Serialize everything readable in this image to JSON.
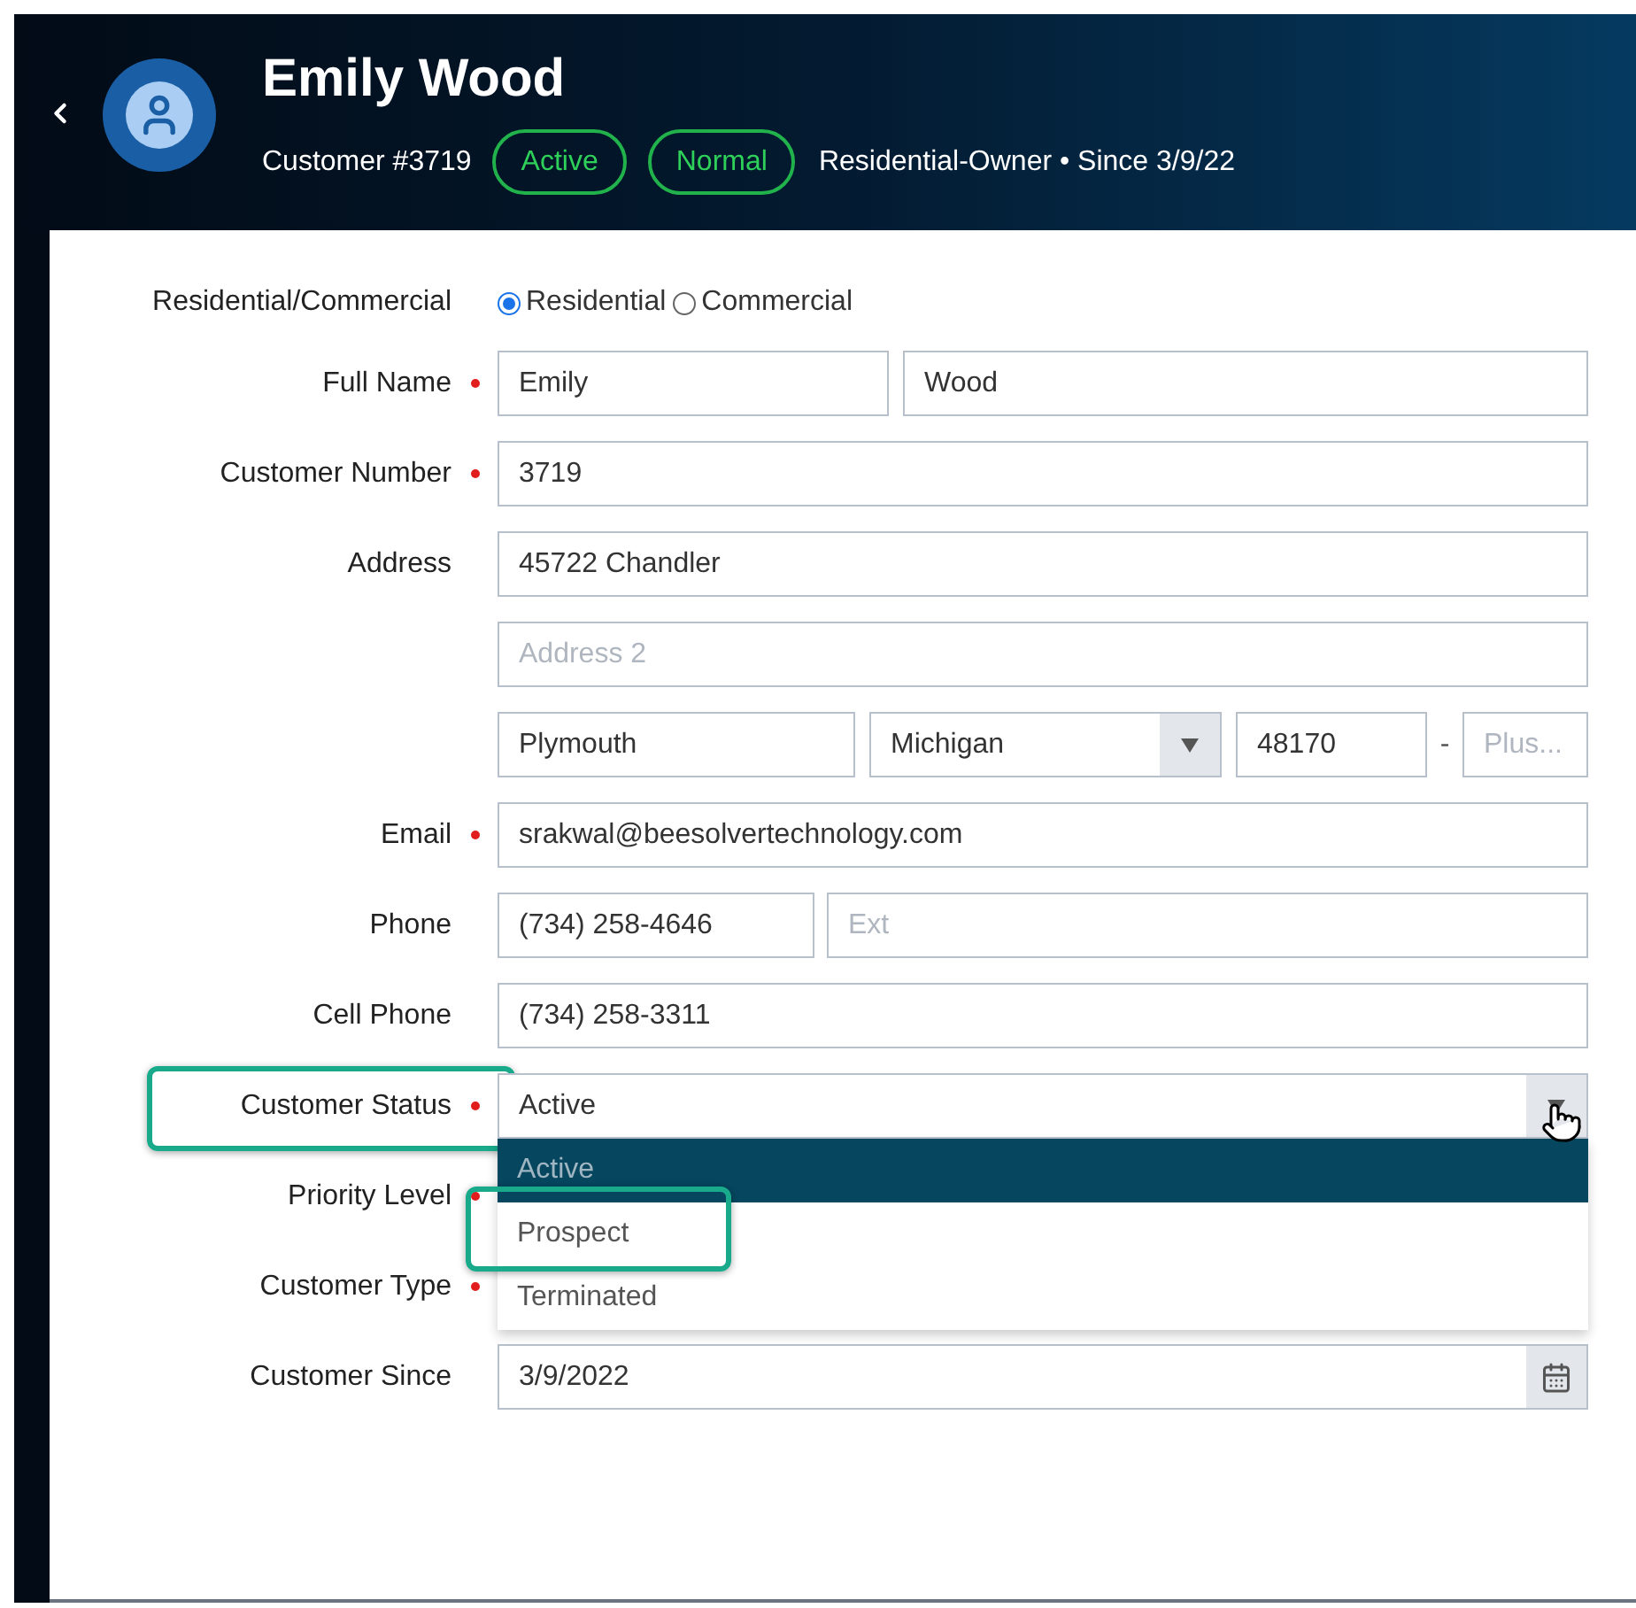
{
  "header": {
    "name": "Emily Wood",
    "customer_number": "Customer #3719",
    "badges": [
      "Active",
      "Normal"
    ],
    "meta": "Residential-Owner • Since 3/9/22"
  },
  "rows": [
    {
      "kind": "radio",
      "label": "Residential/Commercial",
      "options": [
        {
          "label": "Residential",
          "selected": true
        },
        {
          "label": "Commercial",
          "selected": false
        }
      ]
    },
    {
      "kind": "name",
      "label": "Full Name",
      "required": true,
      "fields": [
        {
          "value": "Emily"
        },
        {
          "value": "Wood"
        }
      ]
    },
    {
      "kind": "single",
      "label": "Customer Number",
      "required": true,
      "fields": [
        {
          "value": "3719"
        }
      ]
    },
    {
      "kind": "single",
      "label": "Address",
      "required": false,
      "fields": [
        {
          "value": "45722 Chandler"
        }
      ]
    },
    {
      "kind": "single",
      "required": false,
      "fields": [
        {
          "placeholder": "Address 2"
        }
      ]
    },
    {
      "kind": "city",
      "required": false,
      "fields": [
        {
          "value": "Plymouth"
        },
        {
          "value": "Michigan"
        },
        {
          "value": "48170"
        },
        {
          "placeholder": "Plus..."
        }
      ],
      "separator": "-"
    },
    {
      "kind": "single",
      "label": "Email",
      "required": true,
      "fields": [
        {
          "value": "srakwal@beesolvertechnology.com"
        }
      ]
    },
    {
      "kind": "phone",
      "label": "Phone",
      "required": false,
      "fields": [
        {
          "value": "(734) 258-4646"
        },
        {
          "placeholder": "Ext"
        }
      ]
    },
    {
      "kind": "single",
      "label": "Cell Phone",
      "required": false,
      "fields": [
        {
          "value": "(734) 258-3311"
        }
      ]
    },
    {
      "kind": "select",
      "label": "Customer Status",
      "required": true,
      "highlighted": true,
      "value": "Active",
      "open": true,
      "options": [
        {
          "label": "Active",
          "selected": true,
          "highlighted": false
        },
        {
          "label": "Prospect",
          "selected": false,
          "highlighted": true
        },
        {
          "label": "Terminated",
          "selected": false,
          "highlighted": false
        }
      ]
    },
    {
      "kind": "hidden",
      "label": "Priority Level",
      "required": true
    },
    {
      "kind": "hidden",
      "label": "Customer Type",
      "required": true
    },
    {
      "kind": "date",
      "label": "Customer Since",
      "required": false,
      "fields": [
        {
          "value": "3/9/2022"
        }
      ]
    }
  ]
}
